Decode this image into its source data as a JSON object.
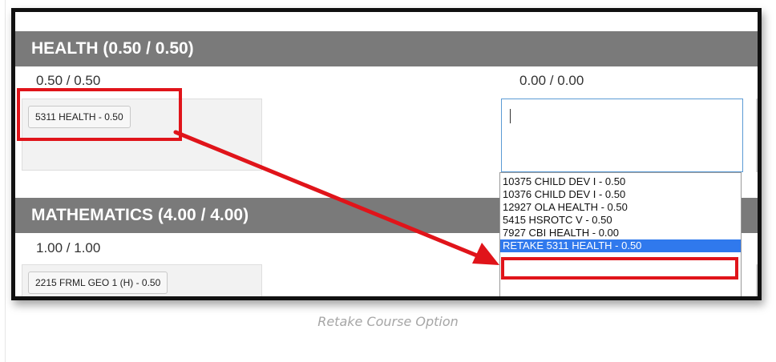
{
  "health": {
    "title": "HEALTH (0.50 / 0.50)",
    "left_credits": "0.50 / 0.50",
    "right_credits": "0.00 / 0.00",
    "course": "5311 HEALTH - 0.50"
  },
  "math": {
    "title": "MATHEMATICS (4.00 / 4.00)",
    "left_credits": "1.00 / 1.00",
    "course": "2215 FRML GEO 1 (H) - 0.50"
  },
  "dropdown": {
    "options": [
      "10375 CHILD DEV I - 0.50",
      "10376 CHILD DEV I - 0.50",
      "12927 OLA HEALTH - 0.50",
      "5415 HSROTC V - 0.50",
      "7927 CBI HEALTH - 0.00",
      "RETAKE 5311 HEALTH - 0.50"
    ],
    "selected_index": 5
  },
  "caption": "Retake Course Option",
  "colors": {
    "highlight": "#e0141a",
    "header": "#7a7a7a",
    "selection": "#3079ed"
  }
}
